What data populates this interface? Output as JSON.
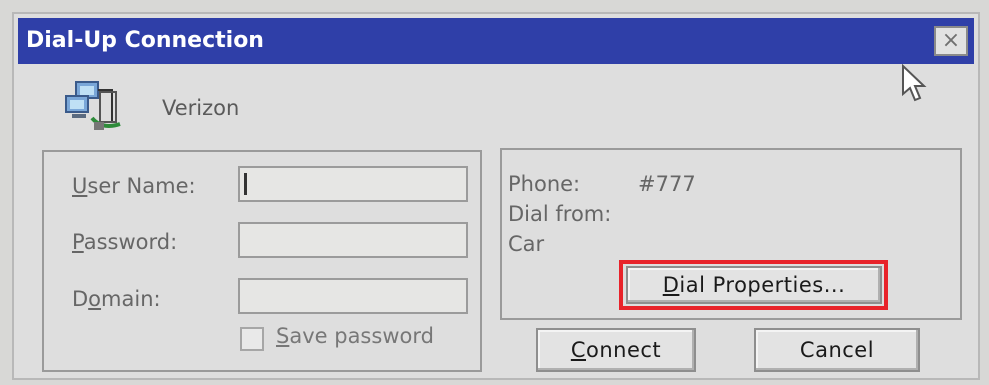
{
  "window": {
    "title": "Dial-Up Connection",
    "close_label": "×"
  },
  "connection": {
    "name": "Verizon",
    "icon": "network-connection-icon"
  },
  "credentials": {
    "user_name_label": "User Name:",
    "user_name_label_accel": "U",
    "user_name_label_rest": "ser Name:",
    "user_name_value": "",
    "password_label": "Password:",
    "password_label_accel": "P",
    "password_label_rest": "assword:",
    "password_value": "",
    "domain_label": "Domain:",
    "domain_label_pre": "D",
    "domain_label_accel": "o",
    "domain_label_rest": "main:",
    "domain_value": "",
    "save_password_label": "Save password",
    "save_password_accel": "S",
    "save_password_rest": "ave password",
    "save_password_checked": false
  },
  "details": {
    "phone_label": "Phone:",
    "phone_value": "#777",
    "dial_from_label": "Dial from:",
    "dial_from_value": "Car"
  },
  "buttons": {
    "dial_properties": "Dial Properties...",
    "dial_properties_accel": "D",
    "dial_properties_rest": "ial Properties...",
    "connect": "Connect",
    "connect_accel": "C",
    "connect_rest": "onnect",
    "cancel": "Cancel"
  },
  "colors": {
    "titlebar": "#2f3fa8",
    "highlight": "#e8232a"
  }
}
